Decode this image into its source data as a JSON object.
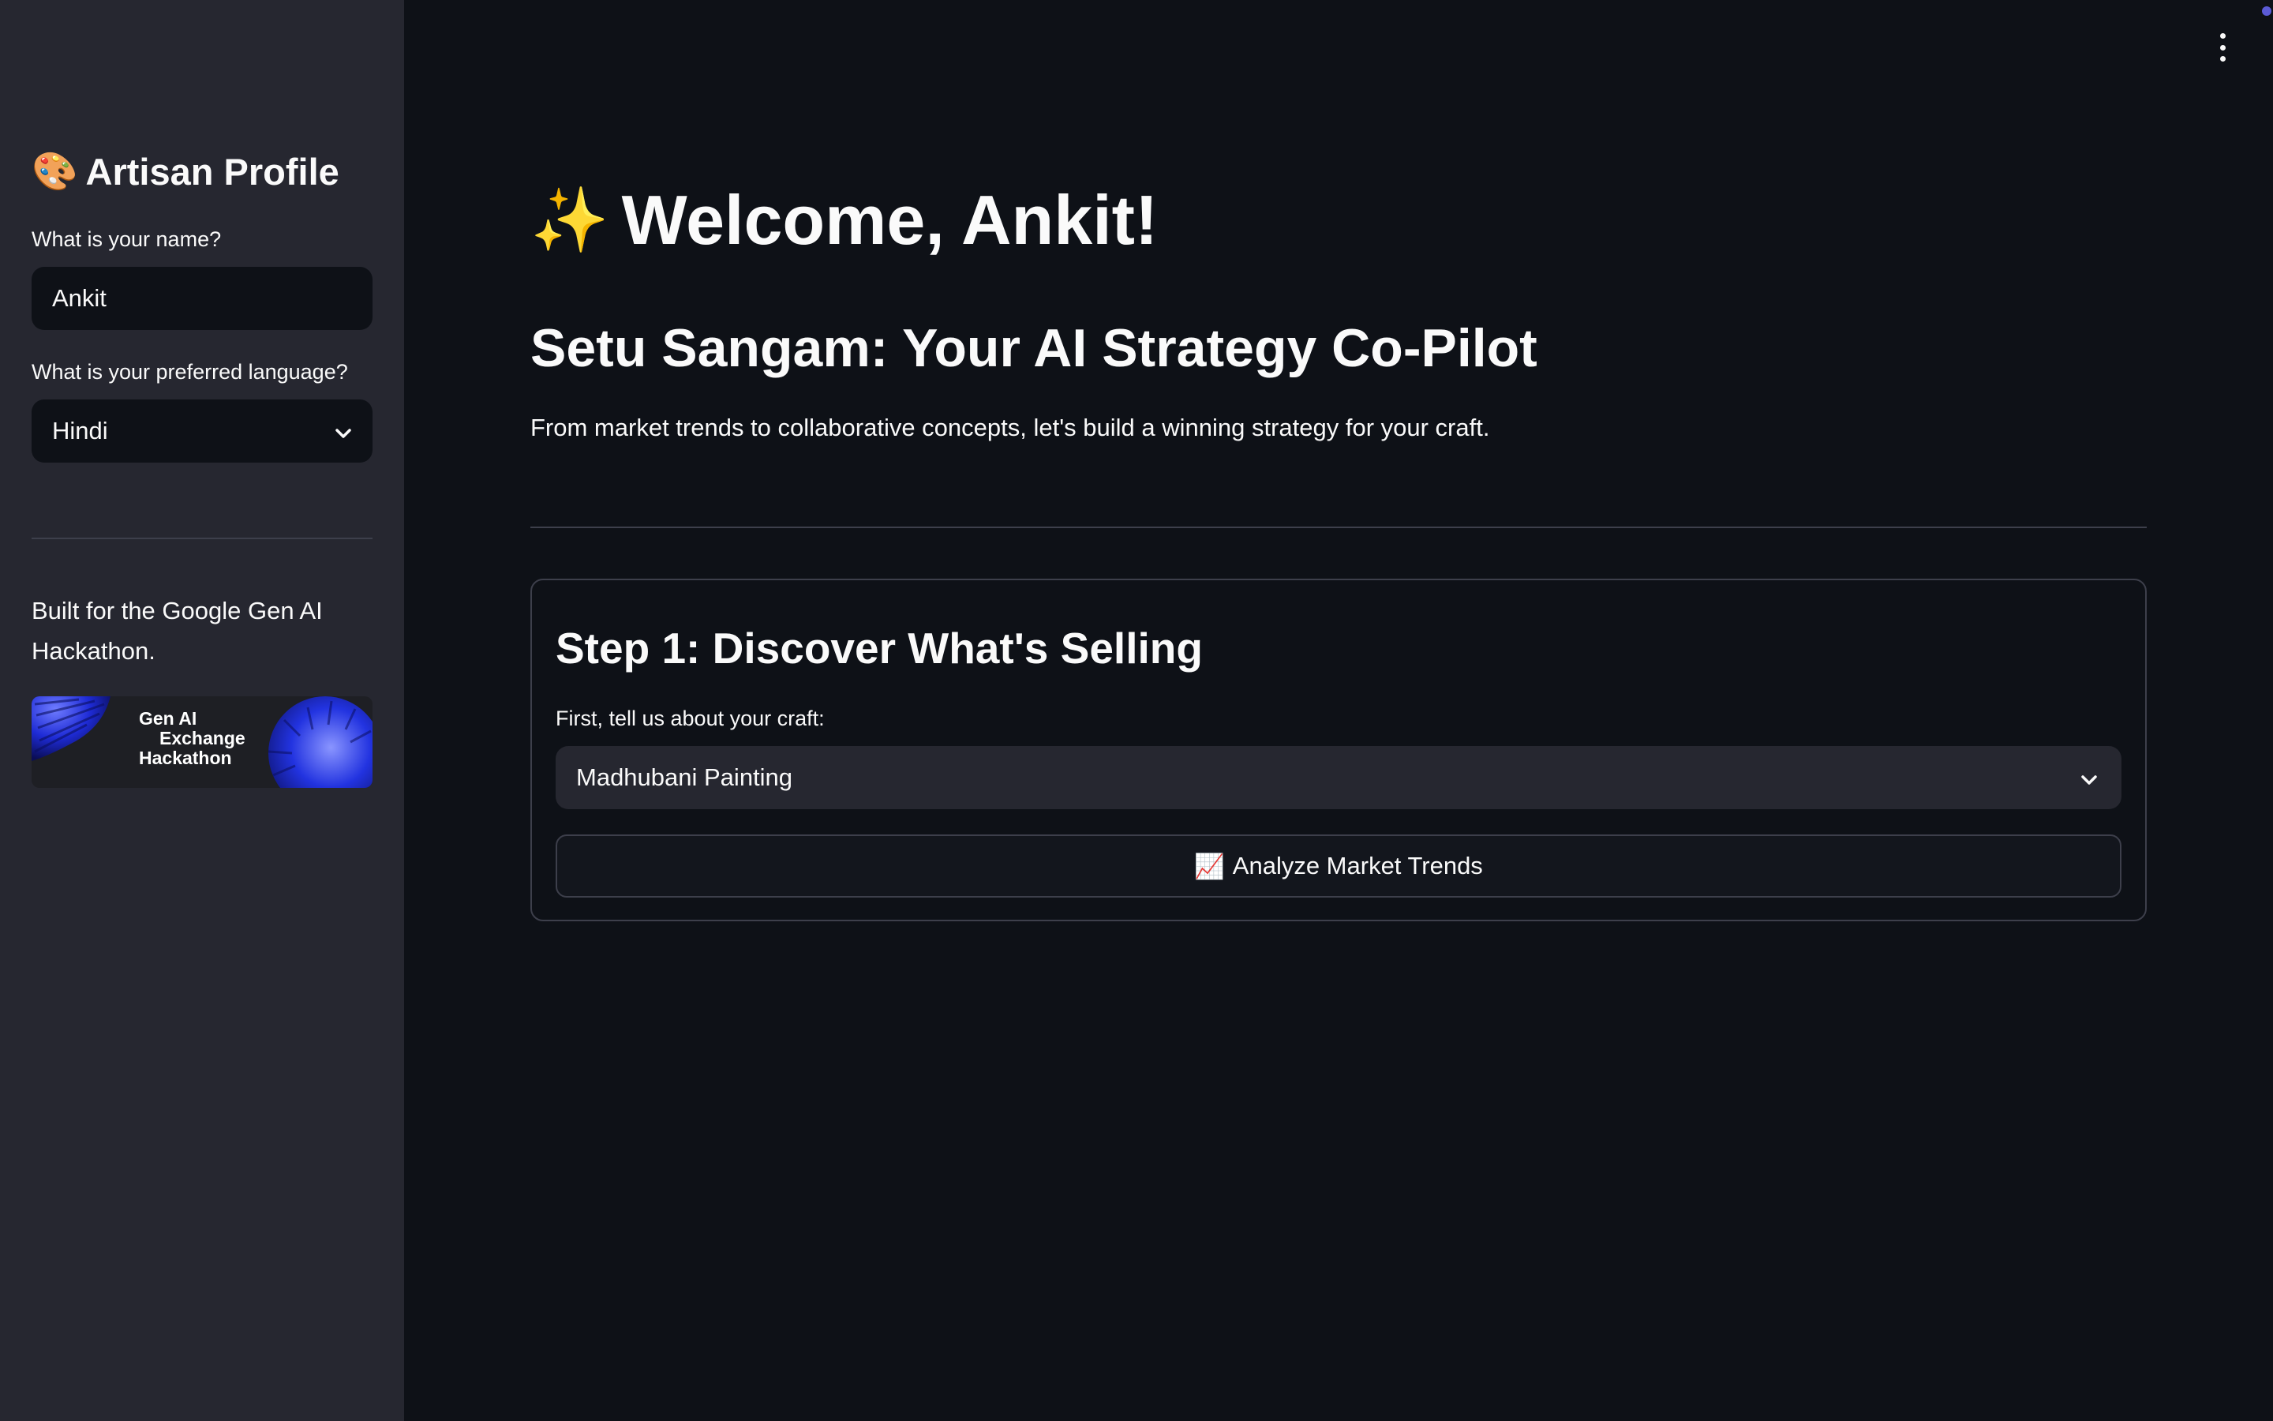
{
  "sidebar": {
    "title_icon": "🎨",
    "title": "Artisan Profile",
    "name_label": "What is your name?",
    "name_value": "Ankit",
    "language_label": "What is your preferred language?",
    "language_value": "Hindi",
    "built_text": "Built for the Google Gen AI Hackathon.",
    "banner": {
      "line1": "Gen AI",
      "line2": "Exchange",
      "line3": "Hackathon"
    }
  },
  "main": {
    "welcome_icon": "✨",
    "welcome": "Welcome, Ankit!",
    "subtitle": "Setu Sangam: Your AI Strategy Co-Pilot",
    "tagline": "From market trends to collaborative concepts, let's build a winning strategy for your craft.",
    "step1": {
      "title": "Step 1: Discover What's Selling",
      "craft_label": "First, tell us about your craft:",
      "craft_value": "Madhubani Painting",
      "button_icon": "📈",
      "button_label": "Analyze Market Trends"
    }
  },
  "colors": {
    "background": "#0e1117",
    "sidebar": "#262730",
    "text": "#fafafa",
    "border": "#3d3f4b",
    "banner_accent": "#1e2bd6"
  },
  "icons": [
    "palette-icon",
    "chevron-down-icon",
    "sparkles-icon",
    "chart-increasing-icon",
    "more-vertical-icon"
  ]
}
